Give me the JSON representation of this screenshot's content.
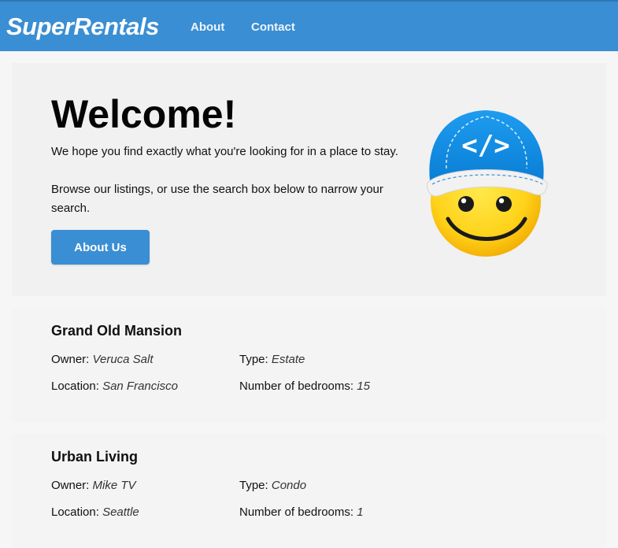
{
  "nav": {
    "brand": "SuperRentals",
    "links": [
      "About",
      "Contact"
    ]
  },
  "jumbo": {
    "title": "Welcome!",
    "line1": "We hope you find exactly what you're looking for in a place to stay.",
    "line2": "Browse our listings, or use the search box below to narrow your search.",
    "button": "About Us",
    "mascot": {
      "icon": "tomster-mascot",
      "cap_text": "</>"
    }
  },
  "rentals": [
    {
      "title": "Grand Old Mansion",
      "owner_label": "Owner:",
      "owner": "Veruca Salt",
      "type_label": "Type:",
      "type": "Estate",
      "location_label": "Location:",
      "location": "San Francisco",
      "bedrooms_label": "Number of bedrooms:",
      "bedrooms": "15"
    },
    {
      "title": "Urban Living",
      "owner_label": "Owner:",
      "owner": "Mike TV",
      "type_label": "Type:",
      "type": "Condo",
      "location_label": "Location:",
      "location": "Seattle",
      "bedrooms_label": "Number of bedrooms:",
      "bedrooms": "1"
    }
  ],
  "colors": {
    "brand": "#3a8ed3",
    "background": "#f6f6f6"
  }
}
